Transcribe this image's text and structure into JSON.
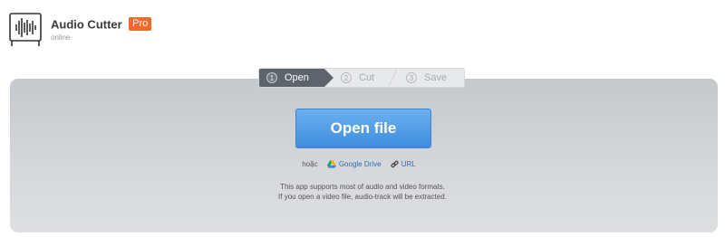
{
  "header": {
    "brand_name": "Audio Cutter",
    "brand_badge": "Pro",
    "brand_sub": "online"
  },
  "steps": [
    {
      "num": "1",
      "label": "Open",
      "active": true
    },
    {
      "num": "2",
      "label": "Cut",
      "active": false
    },
    {
      "num": "3",
      "label": "Save",
      "active": false
    }
  ],
  "main": {
    "open_button_label": "Open file",
    "or_label": "hoặc",
    "google_drive_label": "Google Drive",
    "url_label": "URL",
    "info_line1": "This app supports most of audio and video formats.",
    "info_line2": "If you open a video file, audio-track will be extracted."
  },
  "colors": {
    "accent_blue": "#4a97e3",
    "badge_orange": "#f06a2c",
    "active_step": "#5d646b"
  }
}
